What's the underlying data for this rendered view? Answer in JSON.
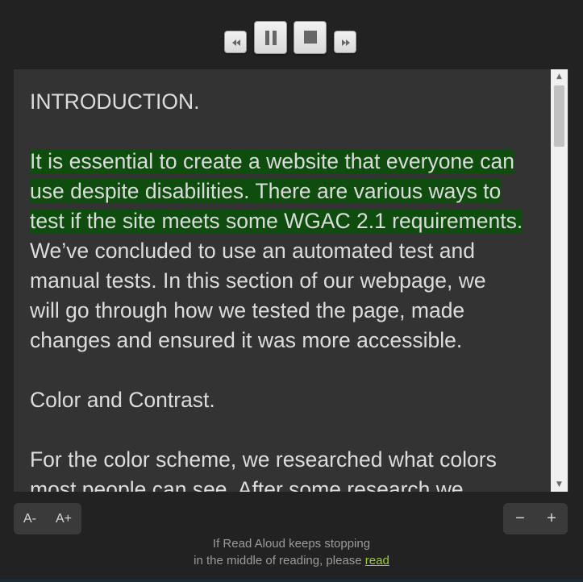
{
  "controls": {
    "rewind_icon": "rewind-icon",
    "pause_icon": "pause-icon",
    "stop_icon": "stop-icon",
    "forward_icon": "fast-forward-icon"
  },
  "reading": {
    "heading": "INTRODUCTION.",
    "highlighted_lines": [
      "It is essential to create a website that everyone can",
      "use despite disabilities. There are various ways to",
      "test if the site meets some WGAC 2.1 requirements."
    ],
    "remaining_lines": [
      "We’ve concluded to use an automated test and",
      "manual tests. In this section of our webpage, we",
      "will go through how we tested the page, made",
      "changes and ensured it was more accessible."
    ],
    "section_heading": "Color and Contrast.",
    "color_lines": [
      "For the color scheme, we researched what colors",
      "most people can see. After some research we"
    ]
  },
  "font_size": {
    "decrease_label": "A-",
    "increase_label": "A+"
  },
  "rate": {
    "decrease_label": "−",
    "increase_label": "+"
  },
  "notice": {
    "line1": "If Read Aloud keeps stopping",
    "line2_prefix": "in the middle of reading, please ",
    "link_label": "read"
  },
  "colors": {
    "background": "#222222",
    "pane": "#333333",
    "highlight": "#0e4d0e",
    "link": "#9acd32"
  }
}
